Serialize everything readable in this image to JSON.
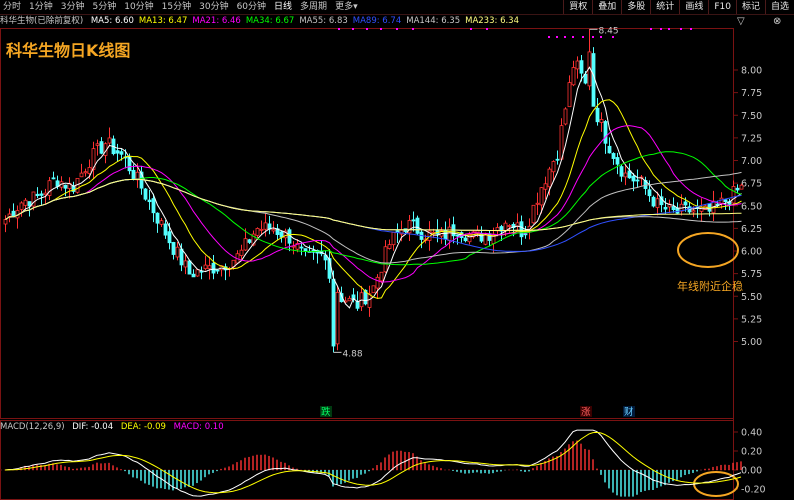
{
  "toolbar": {
    "timeframes": [
      "分时",
      "1分钟",
      "3分钟",
      "5分钟",
      "10分钟",
      "15分钟",
      "30分钟",
      "60分钟",
      "日线",
      "多周期",
      "更多"
    ],
    "right_buttons": [
      "買权",
      "叠加",
      "多股",
      "统计",
      "画线",
      "F10",
      "标记",
      "自选"
    ]
  },
  "header": {
    "stock_label": "科华生物(已除前复权)",
    "ma": [
      {
        "label": "MA5: 6.60",
        "color": "#ffffff"
      },
      {
        "label": "MA13: 6.47",
        "color": "#ffff00"
      },
      {
        "label": "MA21: 6.46",
        "color": "#ff00ff"
      },
      {
        "label": "MA34: 6.67",
        "color": "#00ff00"
      },
      {
        "label": "MA55: 6.83",
        "color": "#c0c0c0"
      },
      {
        "label": "MA89: 6.74",
        "color": "#3050ff"
      },
      {
        "label": "MA144: 6.35",
        "color": "#c8c8c8"
      },
      {
        "label": "MA233: 6.34",
        "color": "#ffff80"
      }
    ],
    "corner_icons": [
      "chevron-down-icon",
      "close-icon"
    ]
  },
  "title_overlay": "科华生物日K线图",
  "annotation": "年线附近企稳",
  "labels": {
    "high": "8.45",
    "low": "4.88",
    "marker_die": "跌",
    "marker_zhang": "涨",
    "marker_cai": "财"
  },
  "macd_header": {
    "name": "MACD(12,26,9)",
    "dif": "DIF: -0.04",
    "dea": "DEA: -0.09",
    "macd": "MACD: 0.10",
    "colors": {
      "name": "#c8c8c8",
      "dif": "#ffffff",
      "dea": "#ffff00",
      "macd": "#ff00ff"
    }
  },
  "colors": {
    "up": "#ff3232",
    "down": "#54ffff",
    "grid": "#7a1212",
    "axis": "#c8c8c8",
    "annotation": "#f5a623"
  },
  "chart_data": [
    {
      "type": "candlestick",
      "title": "科华生物日K线图",
      "yticks": [
        "8.00",
        "7.75",
        "7.50",
        "7.25",
        "7.00",
        "6.75",
        "6.50",
        "6.25",
        "6.00",
        "5.75",
        "5.50",
        "5.25",
        "5.00"
      ],
      "ylim": [
        4.8,
        8.5
      ],
      "high": 8.45,
      "low": 4.88,
      "close_path": [
        6.35,
        6.55,
        6.6,
        6.8,
        6.7,
        7.0,
        7.2,
        7.05,
        6.75,
        6.4,
        6.05,
        5.75,
        5.8,
        5.85,
        5.95,
        6.25,
        6.25,
        6.15,
        5.9,
        5.95,
        5.5,
        5.4,
        5.6,
        6.1,
        6.3,
        6.2,
        6.15,
        6.25,
        6.15,
        6.2,
        6.35,
        6.2,
        6.7,
        7.1,
        8.1,
        7.7,
        7.2,
        6.85,
        6.75,
        6.5,
        6.42,
        6.45,
        6.42,
        6.55,
        6.7
      ],
      "moving_averages": [
        {
          "name": "MA5",
          "value": 6.6
        },
        {
          "name": "MA13",
          "value": 6.47
        },
        {
          "name": "MA21",
          "value": 6.46
        },
        {
          "name": "MA34",
          "value": 6.67
        },
        {
          "name": "MA55",
          "value": 6.83
        },
        {
          "name": "MA89",
          "value": 6.74
        },
        {
          "name": "MA144",
          "value": 6.35
        },
        {
          "name": "MA233",
          "value": 6.34
        }
      ]
    },
    {
      "type": "bar",
      "name": "MACD(12,26,9)",
      "yticks": [
        "0.40",
        "0.20",
        "0.00",
        "-0.20"
      ],
      "ylim": [
        -0.3,
        0.45
      ],
      "dif": -0.04,
      "dea": -0.09,
      "macd": 0.1
    }
  ]
}
